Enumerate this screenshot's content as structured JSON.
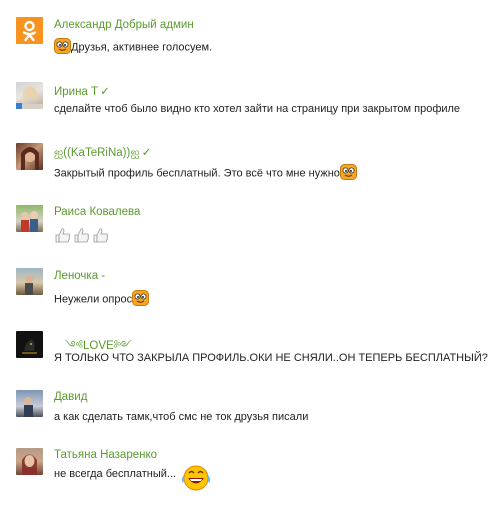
{
  "comments": [
    {
      "author": "Александр Добрый админ",
      "text": "Друзья, активнее голосуем.",
      "avatar": "odnoklassniki-logo-icon"
    },
    {
      "author": "Ирина Т",
      "verified": true,
      "text": "сделайте чтоб было видно кто хотел зайти на страницу при закрытом профиле"
    },
    {
      "author": "ஐ((KaTeRiNa))ஐ",
      "verified": true,
      "text": "Закрытый профиль бесплатный. Это всё что мне нужно"
    },
    {
      "author": "Раиса Ковалева",
      "text": ""
    },
    {
      "author": "Леночка -",
      "text": "Неужели опрос"
    },
    {
      "author": "ㅤ༺LOVE༻",
      "text": "Я ТОЛЬКО ЧТО ЗАКРЫЛА ПРОФИЛЬ.ОКИ НЕ СНЯЛИ..ОН ТЕПЕРЬ БЕСПЛАТНЫЙ?"
    },
    {
      "author": "Давид",
      "text": "а как сделать тамк,чтоб смс не ток друзья писали"
    },
    {
      "author": "Татьяна Назаренко",
      "text": "не всегда бесплатный..."
    }
  ],
  "colors": {
    "author": "#5a9a2f",
    "ok_orange": "#f7931e",
    "text": "#222222"
  }
}
